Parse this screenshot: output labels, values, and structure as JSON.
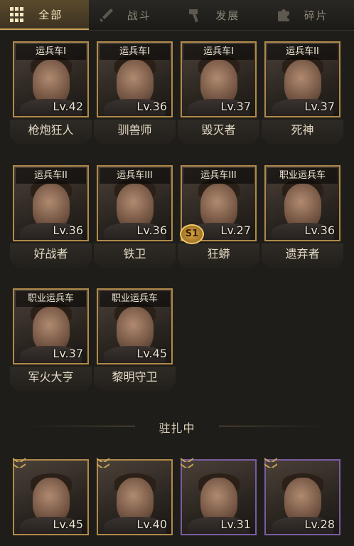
{
  "tabs": [
    {
      "label": "全部",
      "icon": "grid-icon",
      "active": true
    },
    {
      "label": "战斗",
      "icon": "sword-icon",
      "active": false
    },
    {
      "label": "发展",
      "icon": "hammer-icon",
      "active": false
    },
    {
      "label": "碎片",
      "icon": "puzzle-icon",
      "active": false
    }
  ],
  "heroes": [
    {
      "class": "运兵车I",
      "name": "枪炮狂人",
      "level": "Lv.42"
    },
    {
      "class": "运兵车I",
      "name": "驯兽师",
      "level": "Lv.36"
    },
    {
      "class": "运兵车I",
      "name": "毁灭者",
      "level": "Lv.37"
    },
    {
      "class": "运兵车II",
      "name": "死神",
      "level": "Lv.37"
    },
    {
      "class": "运兵车II",
      "name": "好战者",
      "level": "Lv.36"
    },
    {
      "class": "运兵车III",
      "name": "铁卫",
      "level": "Lv.36"
    },
    {
      "class": "运兵车III",
      "name": "狂蟒",
      "level": "Lv.27"
    },
    {
      "class": "职业运兵车",
      "name": "遗弃者",
      "level": "Lv.36"
    },
    {
      "class": "职业运兵车",
      "name": "军火大亨",
      "level": "Lv.37"
    },
    {
      "class": "职业运兵车",
      "name": "黎明守卫",
      "level": "Lv.45"
    }
  ],
  "s1_badge": "S1",
  "stationed": {
    "title": "驻扎中",
    "heroes": [
      {
        "level": "Lv.45",
        "frame": "gold"
      },
      {
        "level": "Lv.40",
        "frame": "gold"
      },
      {
        "level": "Lv.31",
        "frame": "purple"
      },
      {
        "level": "Lv.28",
        "frame": "purple"
      }
    ]
  },
  "colors": {
    "accent": "#c9a35a",
    "background": "#1f1d1a",
    "purple_frame": "#7a5ca0"
  }
}
